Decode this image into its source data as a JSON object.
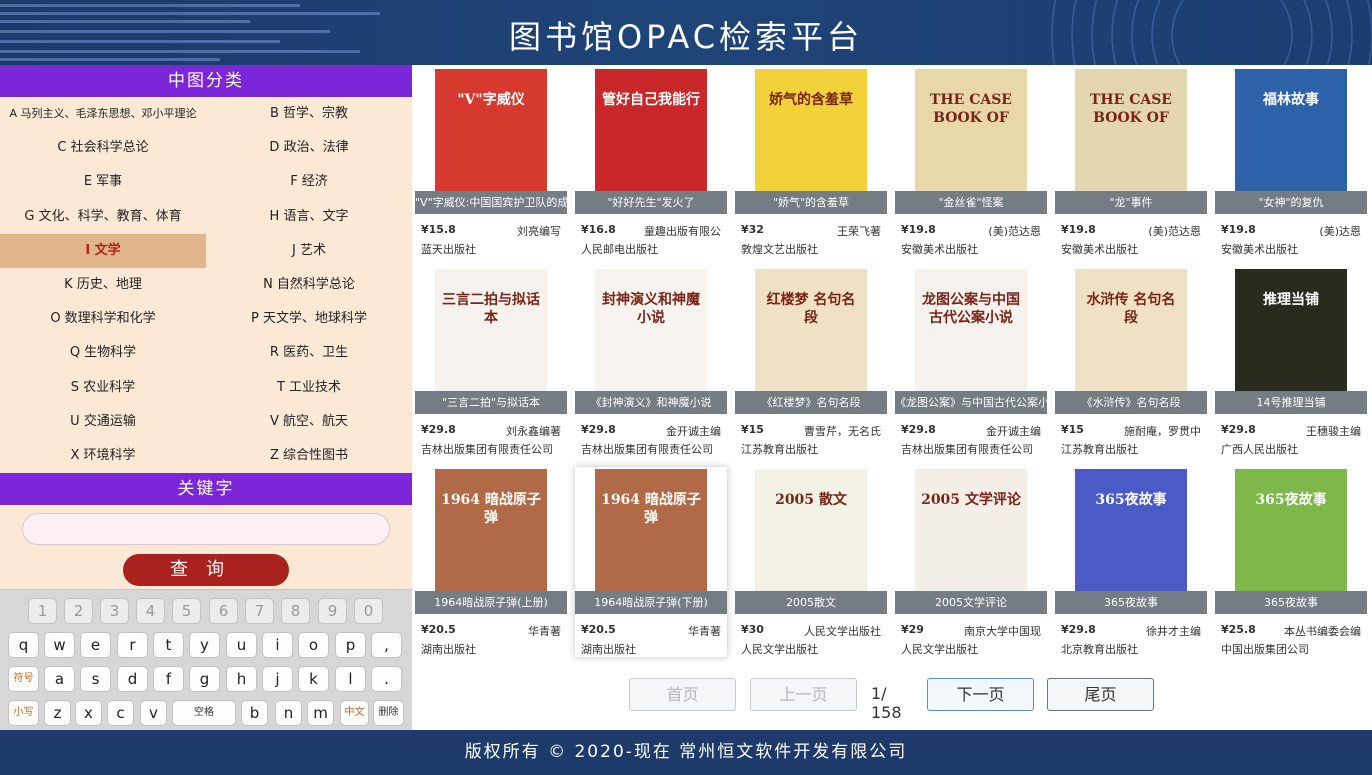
{
  "header": {
    "title": "图书馆OPAC检索平台"
  },
  "footer": {
    "copyright": "版权所有 © 2020-现在 常州恒文软件开发有限公司"
  },
  "sidebar": {
    "category_heading": "中图分类",
    "categories": [
      {
        "label": "A 马列主义、毛泽东思想、邓小平理论",
        "active": false
      },
      {
        "label": "B 哲学、宗教",
        "active": false
      },
      {
        "label": "C 社会科学总论",
        "active": false
      },
      {
        "label": "D 政治、法律",
        "active": false
      },
      {
        "label": "E 军事",
        "active": false
      },
      {
        "label": "F 经济",
        "active": false
      },
      {
        "label": "G 文化、科学、教育、体育",
        "active": false
      },
      {
        "label": "H 语言、文字",
        "active": false
      },
      {
        "label": "I 文学",
        "active": true
      },
      {
        "label": "J 艺术",
        "active": false
      },
      {
        "label": "K 历史、地理",
        "active": false
      },
      {
        "label": "N 自然科学总论",
        "active": false
      },
      {
        "label": "O 数理科学和化学",
        "active": false
      },
      {
        "label": "P 天文学、地球科学",
        "active": false
      },
      {
        "label": "Q 生物科学",
        "active": false
      },
      {
        "label": "R 医药、卫生",
        "active": false
      },
      {
        "label": "S 农业科学",
        "active": false
      },
      {
        "label": "T 工业技术",
        "active": false
      },
      {
        "label": "U 交通运输",
        "active": false
      },
      {
        "label": "V 航空、航天",
        "active": false
      },
      {
        "label": "X 环境科学",
        "active": false
      },
      {
        "label": "Z 综合性图书",
        "active": false
      }
    ],
    "keyword_heading": "关键字",
    "keyword_value": "",
    "search_label": "查询"
  },
  "keyboard": {
    "row_numbers": [
      "1",
      "2",
      "3",
      "4",
      "5",
      "6",
      "7",
      "8",
      "9",
      "0"
    ],
    "row_1": [
      "q",
      "w",
      "e",
      "r",
      "t",
      "y",
      "u",
      "i",
      "o",
      "p",
      ","
    ],
    "row_2": [
      "符号",
      "a",
      "s",
      "d",
      "f",
      "g",
      "h",
      "j",
      "k",
      "l",
      "."
    ],
    "row_3": [
      "小写",
      "z",
      "x",
      "c",
      "v",
      "空格",
      "b",
      "n",
      "m",
      "中文",
      "删除"
    ]
  },
  "books": [
    {
      "title": "\"V\"字威仪:中国国宾护卫队的成",
      "price": "¥15.8",
      "author": "刘亮编写",
      "publisher": "蓝天出版社",
      "cover": "#d63a2e",
      "cover_text": "\"V\"字威仪"
    },
    {
      "title": "\"好好先生\"发火了",
      "price": "¥16.8",
      "author": "童趣出版有限公",
      "publisher": "人民邮电出版社",
      "cover": "#c8282a",
      "cover_text": "管好自己我能行"
    },
    {
      "title": "\"娇气\"的含羞草",
      "price": "¥32",
      "author": "王荣飞著",
      "publisher": "敦煌文艺出版社",
      "cover": "#f2d23a",
      "cover_text": "娇气的含羞草"
    },
    {
      "title": "\"金丝雀\"怪案",
      "price": "¥19.8",
      "author": "(美)范达恩",
      "publisher": "安徽美术出版社",
      "cover": "#e8d7a8",
      "cover_text": "THE CASE BOOK OF"
    },
    {
      "title": "\"龙\"事件",
      "price": "¥19.8",
      "author": "(美)范达恩",
      "publisher": "安徽美术出版社",
      "cover": "#e4d6b0",
      "cover_text": "THE CASE BOOK OF"
    },
    {
      "title": "\"女神\"的复仇",
      "price": "¥19.8",
      "author": "(美)达恩",
      "publisher": "安徽美术出版社",
      "cover": "#2e62a8",
      "cover_text": "福林故事"
    },
    {
      "title": "\"三言二拍\"与拟话本",
      "price": "¥29.8",
      "author": "刘永鑫编著",
      "publisher": "吉林出版集团有限责任公司",
      "cover": "#f5f2ee",
      "cover_text": "三言二拍与拟话本"
    },
    {
      "title": "《封神演义》和神魔小说",
      "price": "¥29.8",
      "author": "金开诚主编",
      "publisher": "吉林出版集团有限责任公司",
      "cover": "#f7f4ef",
      "cover_text": "封神演义和神魔小说"
    },
    {
      "title": "《红楼梦》名句名段",
      "price": "¥15",
      "author": "曹雪芹，无名氏",
      "publisher": "江苏教育出版社",
      "cover": "#efe2c4",
      "cover_text": "红楼梦 名句名段"
    },
    {
      "title": "《龙图公案》与中国古代公案小",
      "price": "¥29.8",
      "author": "金开诚主编",
      "publisher": "吉林出版集团有限责任公司",
      "cover": "#f5f2ee",
      "cover_text": "龙图公案与中国古代公案小说"
    },
    {
      "title": "《水浒传》名句名段",
      "price": "¥15",
      "author": "施耐庵，罗贯中",
      "publisher": "江苏教育出版社",
      "cover": "#efe2c4",
      "cover_text": "水浒传 名句名段"
    },
    {
      "title": "14号推理当铺",
      "price": "¥29.8",
      "author": "王穗骏主编",
      "publisher": "广西人民出版社",
      "cover": "#2a2a1e",
      "cover_text": "推理当铺"
    },
    {
      "title": "1964暗战原子弹(上册)",
      "price": "¥20.5",
      "author": "华青著",
      "publisher": "湖南出版社",
      "cover": "#b06a48",
      "cover_text": "1964 暗战原子弹"
    },
    {
      "title": "1964暗战原子弹(下册)",
      "price": "¥20.5",
      "author": "华青著",
      "publisher": "湖南出版社",
      "cover": "#b06a48",
      "cover_text": "1964 暗战原子弹"
    },
    {
      "title": "2005散文",
      "price": "¥30",
      "author": "人民文学出版社",
      "publisher": "人民文学出版社",
      "cover": "#f3f0e4",
      "cover_text": "2005 散文"
    },
    {
      "title": "2005文学评论",
      "price": "¥29",
      "author": "南京大学中国现",
      "publisher": "人民文学出版社",
      "cover": "#f3efe7",
      "cover_text": "2005 文学评论"
    },
    {
      "title": "365夜故事",
      "price": "¥29.8",
      "author": "徐井才主编",
      "publisher": "北京教育出版社",
      "cover": "#4a5bc8",
      "cover_text": "365夜故事"
    },
    {
      "title": "365夜故事",
      "price": "¥25.8",
      "author": "本丛书编委会编",
      "publisher": "中国出版集团公司",
      "cover": "#7fb84a",
      "cover_text": "365夜故事"
    }
  ],
  "pager": {
    "first": "首页",
    "prev": "上一页",
    "info": "1/ 158",
    "next": "下一页",
    "last": "尾页"
  },
  "colors": {
    "header": "#1d3a6b",
    "accent": "#7b27d9",
    "search": "#a9221e",
    "panel": "#fbe9d6"
  }
}
